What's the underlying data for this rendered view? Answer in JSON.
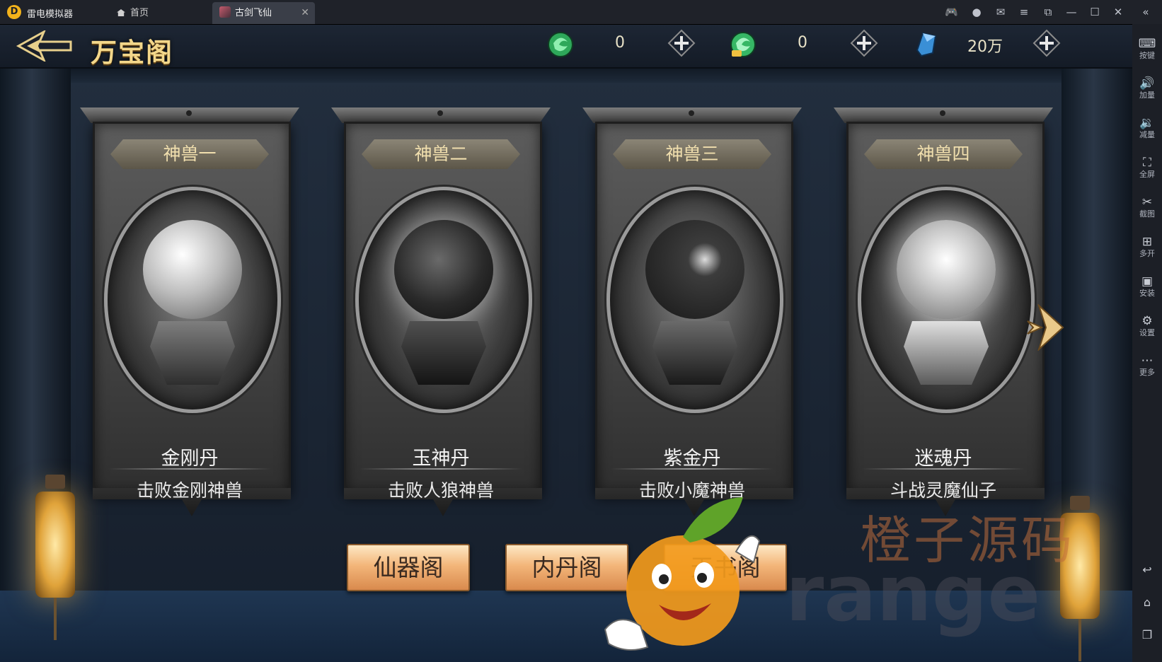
{
  "emulator": {
    "app_name": "雷电模拟器",
    "tabs": [
      {
        "label": "首页"
      },
      {
        "label": "古剑飞仙"
      }
    ],
    "sidebar": [
      {
        "label": "按键"
      },
      {
        "label": "加量"
      },
      {
        "label": "减量"
      },
      {
        "label": "全屏"
      },
      {
        "label": "截图"
      },
      {
        "label": "多开"
      },
      {
        "label": "安装"
      },
      {
        "label": "设置"
      },
      {
        "label": "更多"
      }
    ]
  },
  "game": {
    "title": "万宝阁",
    "currencies": [
      {
        "icon": "jade-spirit-icon",
        "value": "0"
      },
      {
        "icon": "bound-jade-icon",
        "value": "0"
      },
      {
        "icon": "blue-crystal-icon",
        "value": "20万"
      }
    ],
    "cards": [
      {
        "tag": "神兽一",
        "name": "金刚丹",
        "desc": "击败金刚神兽"
      },
      {
        "tag": "神兽二",
        "name": "玉神丹",
        "desc": "击败人狼神兽"
      },
      {
        "tag": "神兽三",
        "name": "紫金丹",
        "desc": "击败小魔神兽"
      },
      {
        "tag": "神兽四",
        "name": "迷魂丹",
        "desc": "斗战灵魔仙子"
      }
    ],
    "bottom_buttons": [
      {
        "label": "仙器阁"
      },
      {
        "label": "内丹阁"
      },
      {
        "label": "天书阁"
      }
    ]
  },
  "watermark": {
    "text": "橙子源码",
    "latin": "range"
  },
  "colors": {
    "title_gold": "#f3d78a",
    "button_orange": "#f3b67a",
    "currency_green": "#3fbf6a",
    "currency_blue": "#3a8fd6"
  }
}
